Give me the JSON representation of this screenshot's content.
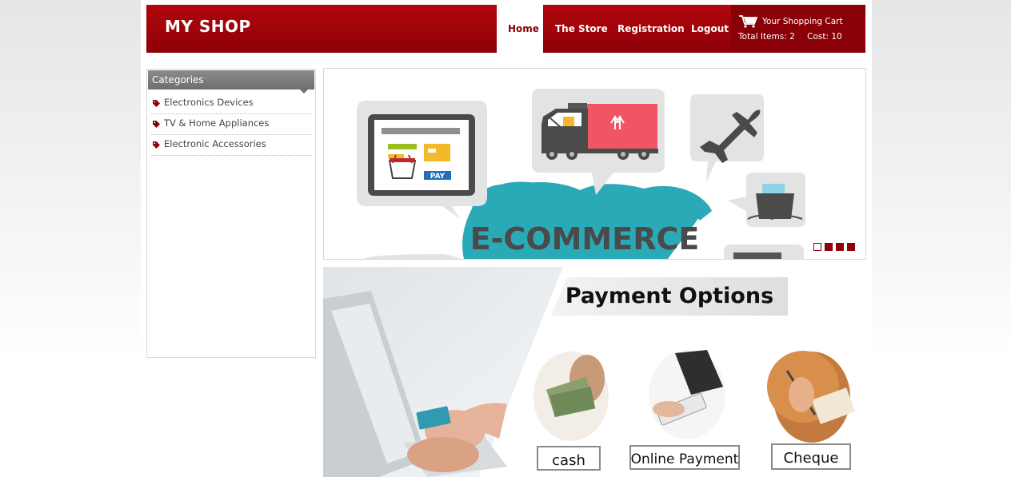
{
  "header": {
    "logo": "MY SHOP"
  },
  "nav": {
    "home": "Home",
    "store": "The Store",
    "registration": "Registration",
    "logout": "Logout"
  },
  "cart": {
    "title": "Your Shopping Cart",
    "items_label": "Total Items: 2",
    "cost_label": "Cost: 10"
  },
  "sidebar": {
    "heading": "Categories",
    "items": [
      {
        "label": "Electronics Devices"
      },
      {
        "label": "TV & Home Appliances"
      },
      {
        "label": "Electronic Accessories"
      }
    ]
  },
  "banner": {
    "title": "E-COMMERCE",
    "pay_label": "PAY"
  },
  "payment": {
    "title": "Payment Options",
    "options": [
      {
        "label": "cash"
      },
      {
        "label": "Online Payment"
      },
      {
        "label": "Cheque"
      }
    ]
  },
  "colors": {
    "brand": "#a00009",
    "brand_dark": "#8a0007",
    "teal": "#2aa9b6",
    "sidebar_head": "#7a7a7a"
  }
}
